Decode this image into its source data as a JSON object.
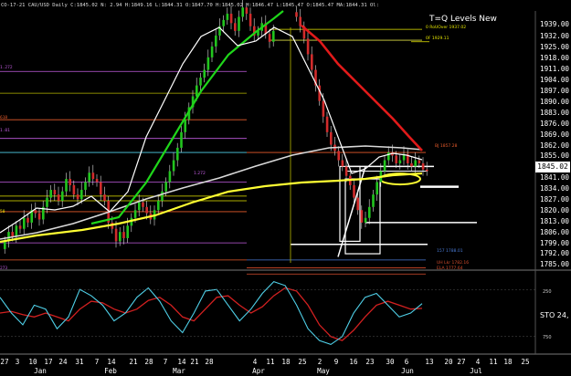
{
  "header": {
    "text": "CO-17-21 CAU/USD Daily C:1845.02 N: 2.94 H:1849.16 L:1844.31 O:1847.70 H:1845.02 H:1846.47 L:1845.47 O:1845.47 MA:1844.31 Ol:"
  },
  "panel_title": "T=Q Levels New",
  "annotations": {
    "upper1": "0 RoUOver 1937.02",
    "upper2": "0F 1929.11",
    "right1": "BJ 1857.28",
    "right2": "157 1788.01",
    "right3": "UH Lkr 1782.16",
    "right4": "ELA 1777.64",
    "left_mid": "1.272",
    "left_side": [
      "1.272",
      "618",
      "1.01",
      "50",
      "273"
    ]
  },
  "price_axis": [
    "1939.00",
    "1932.00",
    "1925.00",
    "1918.00",
    "1911.00",
    "1904.00",
    "1897.00",
    "1890.00",
    "1883.00",
    "1876.00",
    "1869.00",
    "1862.00",
    "1855.00",
    "1848.00",
    "1841.00",
    "1834.00",
    "1827.00",
    "1820.00",
    "1813.00",
    "1806.00",
    "1799.00",
    "1792.00",
    "1785.00"
  ],
  "current_price": "1845.02",
  "oscillator": {
    "label": "STO 24,",
    "level_high": "250",
    "level_low": "750"
  },
  "date_axis": [
    "27",
    "3",
    "10",
    "17",
    "24",
    "31",
    "7",
    "14",
    "21",
    "28",
    "7",
    "14",
    "21",
    "28",
    "4",
    "11",
    "18",
    "25",
    "2",
    "9",
    "16",
    "23",
    "30",
    "6",
    "13",
    "20",
    "27",
    "4",
    "11",
    "18",
    "25"
  ],
  "month_axis": [
    "Jan",
    "Feb",
    "Mar",
    "Apr",
    "May",
    "Jun",
    "Jul"
  ],
  "colors": {
    "background": "#000000",
    "candle_up": "#22c51e",
    "candle_down": "#d22c2c",
    "ma_green": "#1fd61a",
    "ma_red": "#e11a1a",
    "ma_white": "#ffffff",
    "ma_gray": "#d9d9d9",
    "ma_yellow": "#ffff33",
    "sto_fast": "#4fd0e8",
    "sto_slow": "#d22020"
  }
}
